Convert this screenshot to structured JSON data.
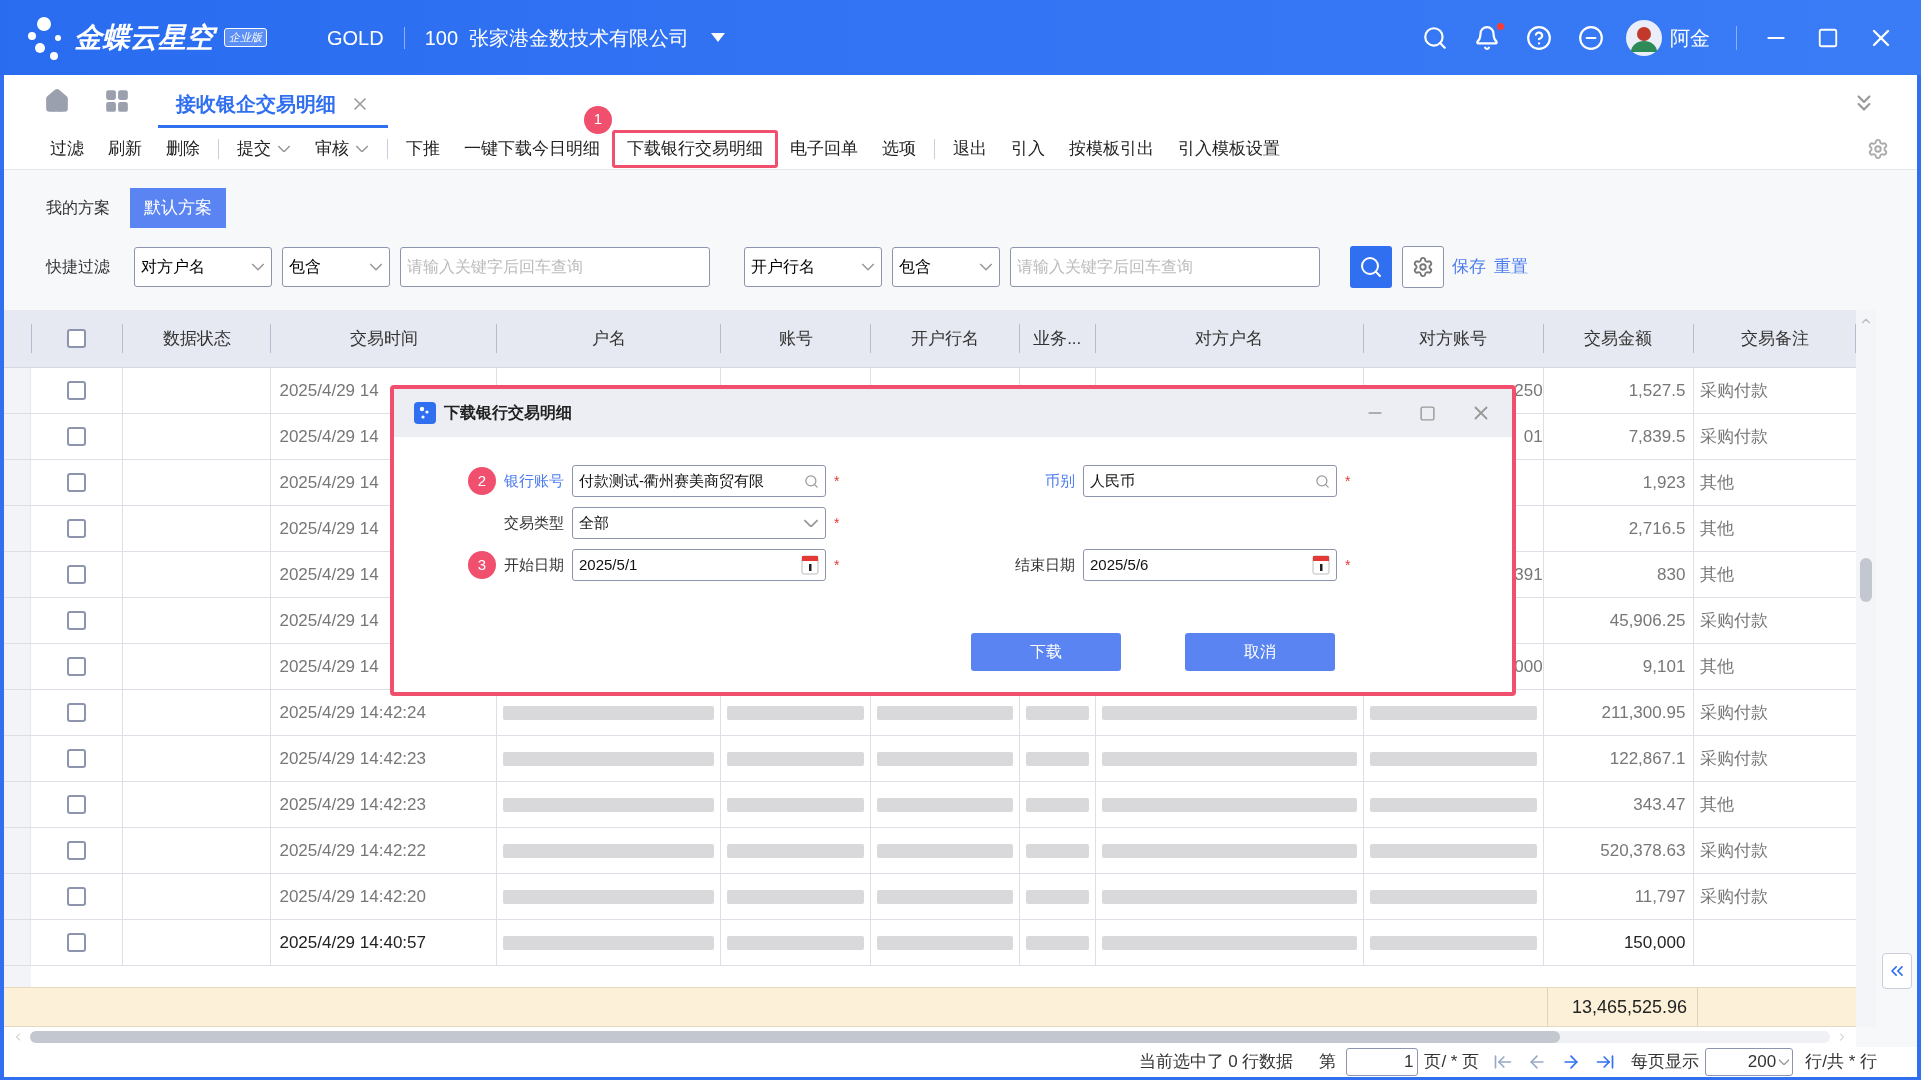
{
  "header": {
    "logo_text": "金蝶云星空",
    "edition_badge": "企业版",
    "tier": "GOLD",
    "company": "100  张家港金数技术有限公司",
    "notification_dot": true,
    "user": "阿金"
  },
  "tabs": [
    {
      "label": "接收银企交易明细",
      "selected": true
    }
  ],
  "toolbar": [
    {
      "label": "过滤",
      "kind": "button"
    },
    {
      "label": "刷新",
      "kind": "button"
    },
    {
      "label": "删除",
      "kind": "button"
    },
    {
      "kind": "divider"
    },
    {
      "label": "提交",
      "kind": "dropdown"
    },
    {
      "label": "审核",
      "kind": "dropdown"
    },
    {
      "kind": "divider"
    },
    {
      "label": "下推",
      "kind": "button"
    },
    {
      "label": "一键下载今日明细",
      "kind": "button"
    },
    {
      "label": "下载银行交易明细",
      "kind": "button",
      "highlighted": true,
      "badge": "1"
    },
    {
      "label": "电子回单",
      "kind": "button"
    },
    {
      "label": "选项",
      "kind": "button"
    },
    {
      "kind": "divider"
    },
    {
      "label": "退出",
      "kind": "button"
    },
    {
      "label": "引入",
      "kind": "button"
    },
    {
      "label": "按模板引出",
      "kind": "button"
    },
    {
      "label": "引入模板设置",
      "kind": "button"
    }
  ],
  "schemes": {
    "label": "我的方案",
    "items": [
      {
        "label": "默认方案",
        "selected": true
      }
    ]
  },
  "quick_filter": {
    "label": "快捷过滤",
    "groups": [
      {
        "field": "对方户名",
        "operator": "包含",
        "placeholder": "请输入关键字后回车查询"
      },
      {
        "field": "开户行名",
        "operator": "包含",
        "placeholder": "请输入关键字后回车查询"
      }
    ],
    "links": [
      "保存",
      "重置"
    ]
  },
  "table": {
    "columns": [
      "数据状态",
      "交易时间",
      "户名",
      "账号",
      "开户行名",
      "业务...",
      "对方户名",
      "对方账号",
      "交易金额",
      "交易备注"
    ],
    "header_checked": false,
    "rows": [
      {
        "checked": false,
        "time": "2025/4/29 14",
        "account_tail": "250",
        "amount": "1,527.5",
        "remark": "采购付款",
        "emphasized": false
      },
      {
        "checked": false,
        "time": "2025/4/29 14",
        "account_tail": "01",
        "amount": "7,839.5",
        "remark": "采购付款",
        "emphasized": false
      },
      {
        "checked": false,
        "time": "2025/4/29 14",
        "amount": "1,923",
        "remark": "其他",
        "emphasized": false
      },
      {
        "checked": false,
        "time": "2025/4/29 14",
        "amount": "2,716.5",
        "remark": "其他",
        "emphasized": false
      },
      {
        "checked": false,
        "time": "2025/4/29 14",
        "account_tail": "391",
        "amount": "830",
        "remark": "其他",
        "emphasized": false
      },
      {
        "checked": false,
        "time": "2025/4/29 14",
        "amount": "45,906.25",
        "remark": "采购付款",
        "emphasized": false
      },
      {
        "checked": false,
        "time": "2025/4/29 14",
        "account_tail": "000",
        "amount": "9,101",
        "remark": "其他",
        "emphasized": false
      },
      {
        "checked": false,
        "time": "2025/4/29 14:42:24",
        "amount": "211,300.95",
        "remark": "采购付款",
        "redacted": true,
        "emphasized": false
      },
      {
        "checked": false,
        "time": "2025/4/29 14:42:23",
        "amount": "122,867.1",
        "remark": "采购付款",
        "redacted": true,
        "emphasized": false
      },
      {
        "checked": false,
        "time": "2025/4/29 14:42:23",
        "amount": "343.47",
        "remark": "其他",
        "redacted": true,
        "emphasized": false
      },
      {
        "checked": false,
        "time": "2025/4/29 14:42:22",
        "amount": "520,378.63",
        "remark": "采购付款",
        "redacted": true,
        "emphasized": false
      },
      {
        "checked": false,
        "time": "2025/4/29 14:42:20",
        "amount": "11,797",
        "remark": "采购付款",
        "redacted": true,
        "emphasized": false
      },
      {
        "checked": false,
        "time": "2025/4/29 14:40:57",
        "amount": "150,000",
        "redacted": true,
        "emphasized": true
      }
    ],
    "total_amount": "13,465,525.96"
  },
  "status_bar": {
    "selection": "当前选中了 0 行数据",
    "page_prefix": "第",
    "page": "1",
    "page_suffix": "页/ * 页",
    "per_page_label": "每页显示",
    "per_page": "200",
    "rows_suffix": "行/共 * 行"
  },
  "dialog": {
    "title": "下载银行交易明细",
    "highlighted": true,
    "required_mark": "*",
    "fields": [
      {
        "label": "银行账号",
        "kind": "lookup",
        "value": "付款测试-衢州赛美商贸有限",
        "required": true,
        "link": true,
        "badge": "2"
      },
      {
        "label": "币别",
        "kind": "lookup",
        "value": "人民币",
        "required": true,
        "link": true
      },
      {
        "label": "交易类型",
        "kind": "select",
        "value": "全部",
        "required": true,
        "link": false
      },
      {
        "label": "开始日期",
        "kind": "date",
        "value": "2025/5/1",
        "required": true,
        "link": false,
        "badge": "3"
      },
      {
        "label": "结束日期",
        "kind": "date",
        "value": "2025/5/6",
        "required": true,
        "link": false
      }
    ],
    "buttons": [
      "下载",
      "取消"
    ]
  }
}
